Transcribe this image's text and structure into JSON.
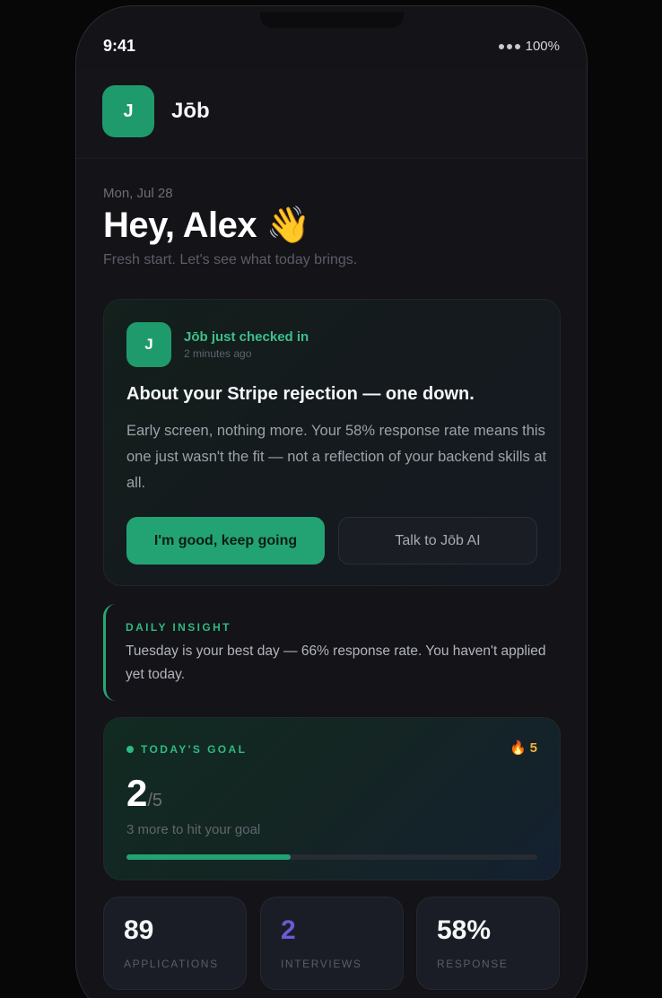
{
  "status_bar": {
    "time": "9:41",
    "battery": "100%"
  },
  "header": {
    "logo_letter": "J",
    "app_name": "Jōb"
  },
  "greeting": {
    "date": "Mon, Jul 28",
    "title": "Hey, Alex",
    "wave": "👋",
    "subtitle": "Fresh start. Let's see what today brings."
  },
  "checkin": {
    "avatar_letter": "J",
    "who": "Jōb just checked in",
    "time": "2 minutes ago",
    "title": "About your Stripe rejection — one down.",
    "body": "Early screen, nothing more. Your 58% response rate means this one just wasn't the fit — not a reflection of your backend skills at all.",
    "primary_button": "I'm good, keep going",
    "secondary_button": "Talk to Jōb AI"
  },
  "insight": {
    "label": "DAILY INSIGHT",
    "text": "Tuesday is your best day — 66% response rate. You haven't applied yet today."
  },
  "goal": {
    "label": "TODAY'S GOAL",
    "streak": "5",
    "streak_icon": "fire-icon",
    "current": "2",
    "total": "/5",
    "subtext": "3 more to hit your goal",
    "progress_fraction": 0.4
  },
  "stats": [
    {
      "value": "89",
      "label": "APPLICATIONS"
    },
    {
      "value": "2",
      "label": "INTERVIEWS"
    },
    {
      "value": "58%",
      "label": "RESPONSE"
    }
  ],
  "colors": {
    "accent": "#23a374",
    "accent_text": "#2fb982",
    "interviews": "#6b5bd6",
    "streak": "#f2b233",
    "background": "#131318"
  }
}
